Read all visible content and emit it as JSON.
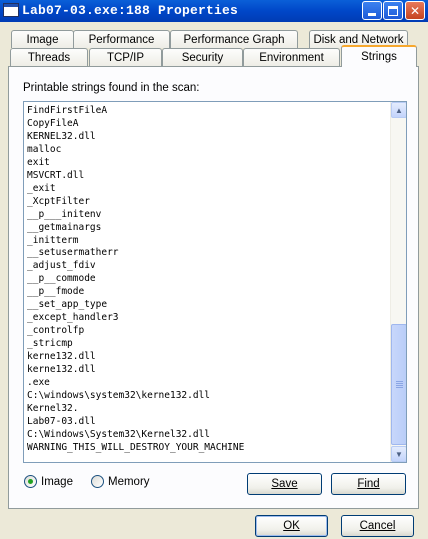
{
  "window": {
    "title": "Lab07-03.exe:188 Properties"
  },
  "tabs_row1": [
    {
      "label": "Image"
    },
    {
      "label": "Performance"
    },
    {
      "label": "Performance Graph"
    },
    {
      "label": "Disk and Network"
    }
  ],
  "tabs_row2": [
    {
      "label": "Threads"
    },
    {
      "label": "TCP/IP"
    },
    {
      "label": "Security"
    },
    {
      "label": "Environment"
    },
    {
      "label": "Strings",
      "active": true
    }
  ],
  "strings_panel": {
    "label": "Printable strings found in the scan:",
    "items": [
      "FindFirstFileA",
      "CopyFileA",
      "KERNEL32.dll",
      "malloc",
      "exit",
      "MSVCRT.dll",
      "_exit",
      "_XcptFilter",
      "__p___initenv",
      "__getmainargs",
      "_initterm",
      "__setusermatherr",
      "_adjust_fdiv",
      "__p__commode",
      "__p__fmode",
      "__set_app_type",
      "_except_handler3",
      "_controlfp",
      "_stricmp",
      "kerne132.dll",
      "kerne132.dll",
      ".exe",
      "C:\\windows\\system32\\kerne132.dll",
      "Kernel32.",
      "Lab07-03.dll",
      "C:\\Windows\\System32\\Kernel32.dll",
      "WARNING_THIS_WILL_DESTROY_YOUR_MACHINE"
    ],
    "scroll_position": 0.75
  },
  "radio": {
    "image_label": "Image",
    "memory_label": "Memory",
    "selected": "Image"
  },
  "buttons": {
    "save_label": "Save",
    "find_label": "Find",
    "ok_label": "OK",
    "cancel_label": "Cancel"
  },
  "colors": {
    "titlebar": "#0054e3",
    "active_tab_highlight": "#f7a82e",
    "dialog_bg": "#ece9d8"
  }
}
